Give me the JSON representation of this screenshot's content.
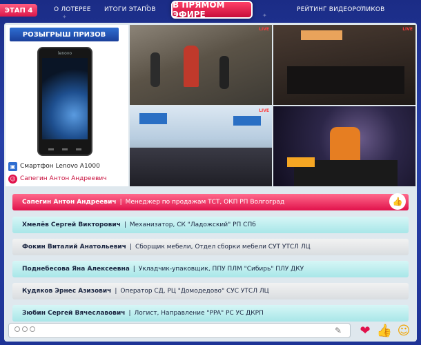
{
  "nav": {
    "stage": "ЭТАП 4",
    "about": "О ЛОТЕРЕЕ",
    "results": "ИТОГИ ЭТАПОВ",
    "live": "В ПРЯМОМ ЭФИРЕ",
    "rating": "РЕЙТИНГ ВИДЕОРОЛИКОВ"
  },
  "prize": {
    "header": "РОЗЫГРЫШ ПРИЗОВ",
    "phone_brand": "lenovo",
    "item": "Смартфон Lenovo A1000",
    "winner": "Сапегин Антон Андреевич"
  },
  "videos": {
    "live_label": "LIVE"
  },
  "entries": [
    {
      "name": "Сапегин Антон Андреевич",
      "detail": "Менеджер по продажам ТСТ, ОКП РП Волгоград",
      "style": "active"
    },
    {
      "name": "Хмелёв Сергей Викторович",
      "detail": "Механизатор, СК \"Ладожский\" РП СПб",
      "style": "aqua"
    },
    {
      "name": "Фокин Виталий Анатольевич",
      "detail": "Сборщик мебели, Отдел сборки мебели СУТ УТСЛ ЛЦ",
      "style": "grey"
    },
    {
      "name": "Поднебесова Яна Алексеевна",
      "detail": "Укладчик-упаковщик, ППУ ПЛМ \"Сибирь\" ПЛУ ДКУ",
      "style": "aqua"
    },
    {
      "name": "Кудяков Эрнес Азизович",
      "detail": "Оператор СД, РЦ \"Домодедово\" СУС УТСЛ ЛЦ",
      "style": "grey"
    },
    {
      "name": "Зюбин Сергей Вячеславович",
      "detail": "Логист, Направление \"PPA\" РС УС ДКРП",
      "style": "aqua"
    }
  ],
  "colors": {
    "accent": "#e1124b",
    "nav_bg": "#1b2c86",
    "aqua": "#a8e6e8"
  }
}
